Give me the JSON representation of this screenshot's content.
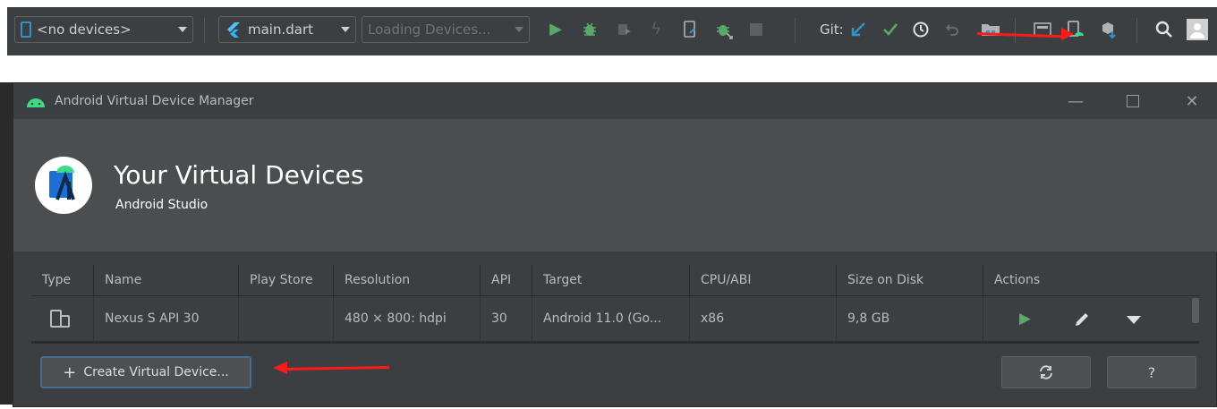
{
  "toolbar": {
    "device_combo": "<no devices>",
    "run_config": "main.dart",
    "loading_combo": "Loading Devices...",
    "git_label": "Git:"
  },
  "dialog": {
    "window_title": "Android Virtual Device Manager",
    "header_title": "Your Virtual Devices",
    "header_subtitle": "Android Studio",
    "columns": [
      "Type",
      "Name",
      "Play Store",
      "Resolution",
      "API",
      "Target",
      "CPU/ABI",
      "Size on Disk",
      "Actions"
    ],
    "rows": [
      {
        "name": "Nexus S API 30",
        "play_store": "",
        "resolution": "480 × 800: hdpi",
        "api": "30",
        "target": "Android 11.0 (Go...",
        "cpu_abi": "x86",
        "size": "9,8 GB"
      }
    ],
    "create_button": "Create Virtual Device...",
    "help_button": "?"
  },
  "colors": {
    "accent_blue": "#466d94",
    "run_green": "#59a869",
    "annotation_red": "#ff1a1a",
    "android_green": "#3ddc84"
  },
  "icons": [
    "phone-icon",
    "flutter-icon",
    "run-icon",
    "debug-icon",
    "profile-icon",
    "hot-reload-icon",
    "device-file-icon",
    "attach-debugger-icon",
    "stop-icon",
    "git-update-icon",
    "git-commit-icon",
    "git-history-icon",
    "git-rollback-icon",
    "project-structure-icon",
    "sdk-manager-icon",
    "avd-manager-icon",
    "plugins-icon",
    "search-icon",
    "avatar"
  ]
}
